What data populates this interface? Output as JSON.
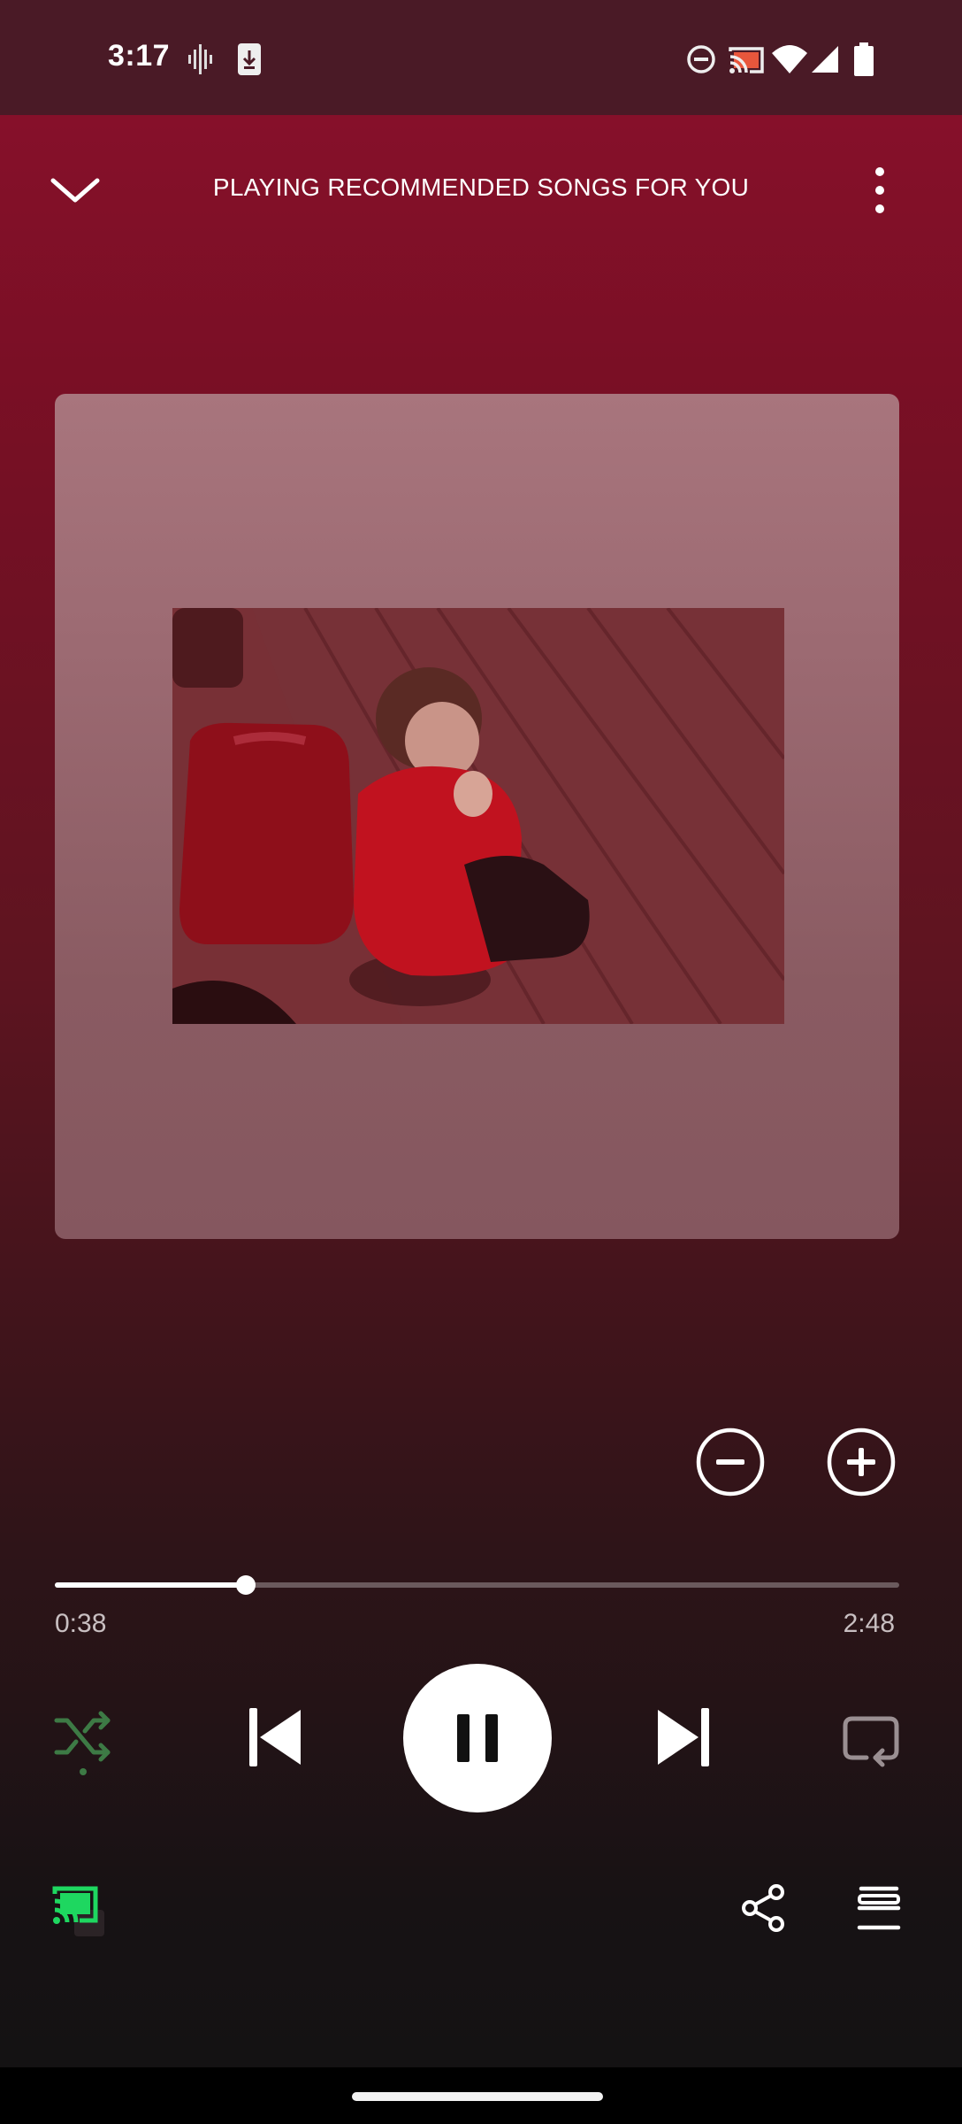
{
  "status_bar": {
    "time": "3:17",
    "icons": [
      "soundwave-icon",
      "download-icon",
      "dnd-icon",
      "cast-icon",
      "wifi-icon",
      "signal-icon",
      "battery-icon"
    ]
  },
  "header": {
    "title": "PLAYING RECOMMENDED SONGS FOR YOU",
    "collapse_icon": "chevron-down-icon",
    "more_icon": "more-vertical-icon"
  },
  "actions": {
    "dislike_icon": "minus-circle-icon",
    "like_icon": "plus-circle-icon"
  },
  "playback": {
    "elapsed": "0:38",
    "total": "2:48",
    "progress_fraction": 0.226
  },
  "controls": {
    "shuffle_icon": "shuffle-icon",
    "previous_icon": "skip-previous-icon",
    "pause_icon": "pause-icon",
    "next_icon": "skip-next-icon",
    "repeat_icon": "repeat-icon"
  },
  "bottom": {
    "cast_icon": "cast-icon",
    "share_icon": "share-icon",
    "queue_icon": "queue-icon"
  },
  "colors": {
    "accent_green": "#1ed760",
    "header_bg": "#86102a",
    "status_bg": "#4a1a26"
  }
}
